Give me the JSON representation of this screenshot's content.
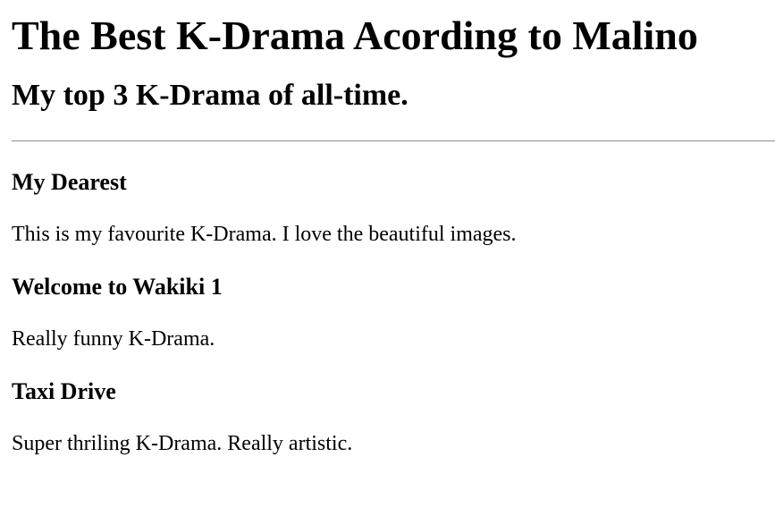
{
  "page": {
    "title": "The Best K-Drama Acording to Malino",
    "subtitle": "My top 3 K-Drama of all-time."
  },
  "dramas": [
    {
      "title": "My Dearest",
      "description": "This is my favourite K-Drama. I love the beautiful images."
    },
    {
      "title": "Welcome to Wakiki 1",
      "description": "Really funny K-Drama."
    },
    {
      "title": "Taxi Drive",
      "description": "Super thriling K-Drama. Really artistic."
    }
  ]
}
